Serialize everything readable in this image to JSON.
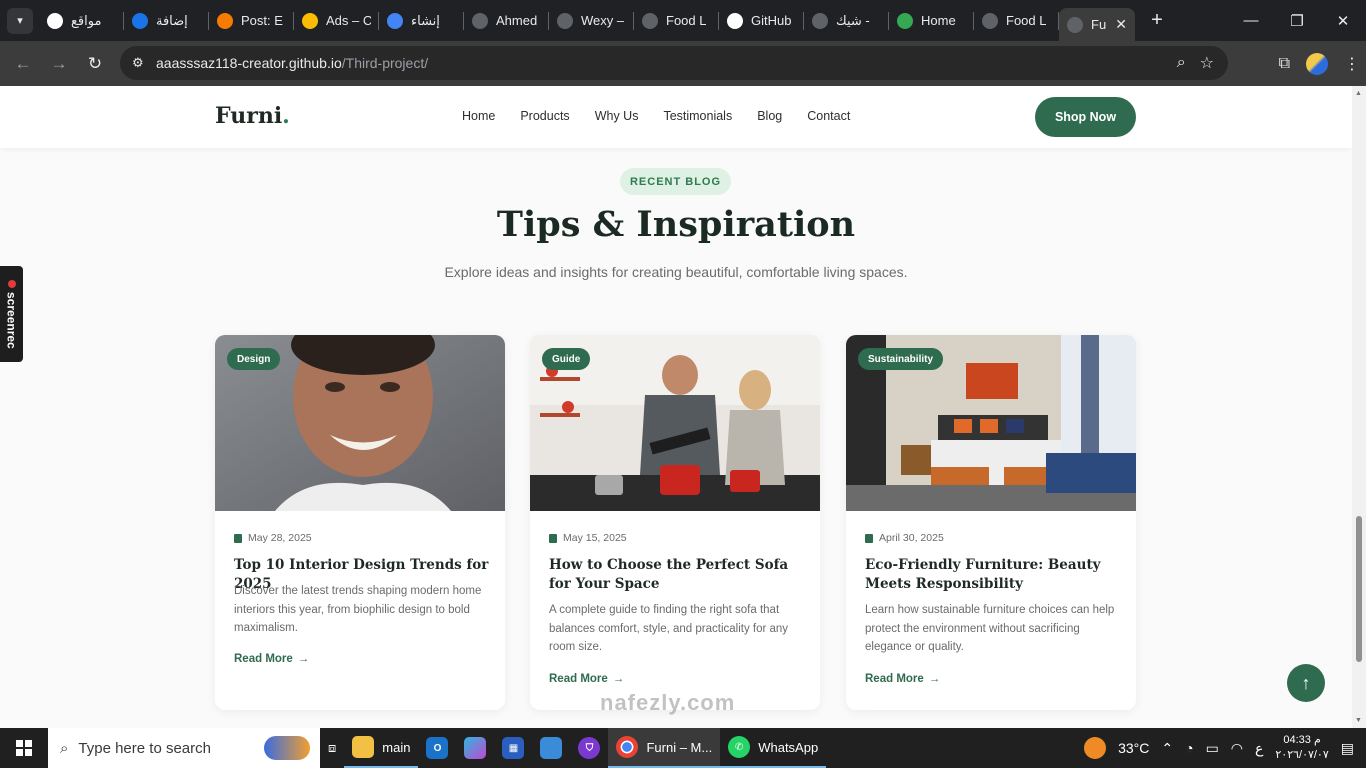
{
  "browser": {
    "tabs": [
      {
        "label": "مواقع",
        "icon": "google-icon",
        "color": "#ffffff"
      },
      {
        "label": "إضافة",
        "icon": "ring-icon",
        "color": "#1a73e8"
      },
      {
        "label": "Post: E",
        "icon": "blogger-icon",
        "color": "#f57c00"
      },
      {
        "label": "Ads – C",
        "icon": "google-ads-icon",
        "color": "#fbbc04"
      },
      {
        "label": "إنشاء",
        "icon": "gemini-icon",
        "color": "#4285f4"
      },
      {
        "label": "Ahmed",
        "icon": "globe-icon",
        "color": "#5f6368"
      },
      {
        "label": "Wexy –",
        "icon": "globe-icon",
        "color": "#5f6368"
      },
      {
        "label": "Food L",
        "icon": "globe-icon",
        "color": "#5f6368"
      },
      {
        "label": "GitHub",
        "icon": "github-icon",
        "color": "#ffffff"
      },
      {
        "label": "شيك -",
        "icon": "globe-icon",
        "color": "#5f6368"
      },
      {
        "label": "Home",
        "icon": "drive-icon",
        "color": "#34a853"
      },
      {
        "label": "Food L",
        "icon": "globe-icon",
        "color": "#5f6368"
      },
      {
        "label": "Fu",
        "icon": "globe-icon",
        "color": "#5f6368",
        "active": true
      }
    ],
    "url_host": "aaasssaz118-creator.github.io",
    "url_path": "/Third-project/"
  },
  "site": {
    "logo": "Furni",
    "logo_dot": ".",
    "nav": [
      "Home",
      "Products",
      "Why Us",
      "Testimonials",
      "Blog",
      "Contact"
    ],
    "cta": "Shop Now"
  },
  "section": {
    "badge": "RECENT BLOG",
    "title": "Tips & Inspiration",
    "subtitle": "Explore ideas and insights for creating beautiful, comfortable living spaces."
  },
  "posts": [
    {
      "category": "Design",
      "date": "May 28, 2025",
      "title": "Top 10 Interior Design Trends for 2025",
      "desc": "Discover the latest trends shaping modern home interiors this year, from biophilic design to bold maximalism.",
      "link": "Read More"
    },
    {
      "category": "Guide",
      "date": "May 15, 2025",
      "title": "How to Choose the Perfect Sofa for Your Space",
      "desc": "A complete guide to finding the right sofa that balances comfort, style, and practicality for any room size.",
      "link": "Read More"
    },
    {
      "category": "Sustainability",
      "date": "April 30, 2025",
      "title": "Eco-Friendly Furniture: Beauty Meets Responsibility",
      "desc": "Learn how sustainable furniture choices can help protect the environment without sacrificing elegance or quality.",
      "link": "Read More"
    }
  ],
  "overlay": {
    "screenrec": "screenrec",
    "watermark": "nafezly.com"
  },
  "taskbar": {
    "search_placeholder": "Type here to search",
    "folder_label": "main",
    "chrome_label": "Furni – M...",
    "whatsapp_label": "WhatsApp",
    "weather": "33°C",
    "lang": "ع",
    "time": "04:33 م",
    "date": "٢٠٢٦/٠٧/٠٧"
  },
  "colors": {
    "brand_green": "#2f6b4f",
    "badge_bg": "#dff1e4",
    "chrome_dark": "#202124"
  }
}
